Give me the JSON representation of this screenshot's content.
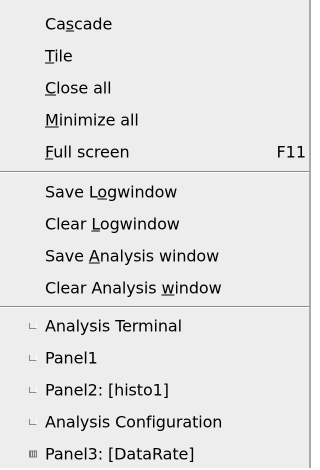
{
  "menu": {
    "window_items": [
      {
        "pre": "Ca",
        "ul": "s",
        "post": "cade",
        "shortcut": ""
      },
      {
        "pre": "",
        "ul": "T",
        "post": "ile",
        "shortcut": ""
      },
      {
        "pre": "",
        "ul": "C",
        "post": "lose all",
        "shortcut": ""
      },
      {
        "pre": "",
        "ul": "M",
        "post": "inimize all",
        "shortcut": ""
      },
      {
        "pre": "",
        "ul": "F",
        "post": "ull screen",
        "shortcut": "F11"
      }
    ],
    "log_items": [
      {
        "pre": "Save L",
        "ul": "o",
        "post": "gwindow"
      },
      {
        "pre": "Clear ",
        "ul": "L",
        "post": "ogwindow"
      },
      {
        "pre": "Save ",
        "ul": "A",
        "post": "nalysis window"
      },
      {
        "pre": "Clear Analysis ",
        "ul": "w",
        "post": "indow"
      }
    ],
    "panel_items": [
      {
        "label": "Analysis Terminal",
        "checked": false
      },
      {
        "label": "Panel1",
        "checked": false
      },
      {
        "label": "Panel2: [histo1]",
        "checked": false
      },
      {
        "label": "Analysis Configuration",
        "checked": false
      },
      {
        "label": "Panel3: [DataRate]",
        "checked": true
      }
    ]
  }
}
